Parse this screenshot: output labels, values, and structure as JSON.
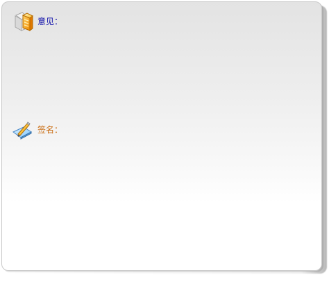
{
  "form": {
    "opinion": {
      "label": "意见：",
      "icon": "opinion-icon"
    },
    "signature": {
      "label": "签名：",
      "icon": "signature-icon"
    }
  },
  "colors": {
    "opinion_label": "#1111aa",
    "signature_label": "#c96b10"
  }
}
